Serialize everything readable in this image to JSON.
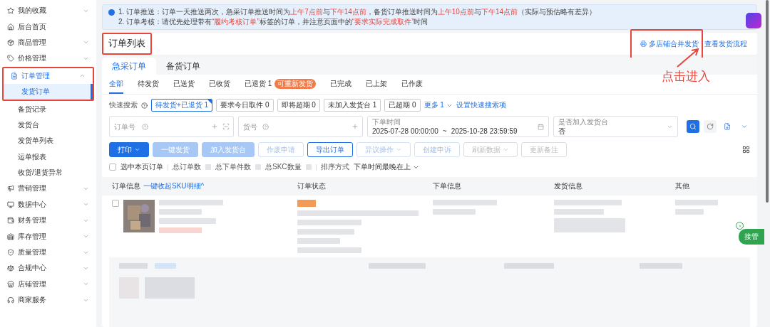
{
  "sidebar": {
    "items": [
      {
        "label": "我的收藏",
        "kind": "group",
        "expanded": false
      },
      {
        "label": "后台首页",
        "kind": "page"
      },
      {
        "label": "商品管理",
        "kind": "group",
        "expanded": false
      },
      {
        "label": "价格管理",
        "kind": "group",
        "expanded": false
      },
      {
        "label": "订单管理",
        "kind": "group",
        "expanded": true,
        "highlighted": true,
        "children": [
          {
            "label": "发货订单",
            "selected": true
          },
          {
            "label": "备货记录",
            "selected": false
          },
          {
            "label": "发货台",
            "selected": false
          },
          {
            "label": "发货单列表",
            "selected": false
          },
          {
            "label": "运单报表",
            "selected": false
          },
          {
            "label": "收货/退货异常",
            "selected": false
          }
        ]
      },
      {
        "label": "营销管理",
        "kind": "group",
        "expanded": false
      },
      {
        "label": "数据中心",
        "kind": "group",
        "expanded": false
      },
      {
        "label": "财务管理",
        "kind": "group",
        "expanded": false
      },
      {
        "label": "库存管理",
        "kind": "group",
        "expanded": false
      },
      {
        "label": "质量管理",
        "kind": "group",
        "expanded": false
      },
      {
        "label": "合规中心",
        "kind": "group",
        "expanded": false
      },
      {
        "label": "店铺管理",
        "kind": "group",
        "expanded": false
      },
      {
        "label": "商家服务",
        "kind": "group",
        "expanded": false
      }
    ]
  },
  "notice": {
    "lines": [
      [
        {
          "text": "1. 订单推送：订单一天推送两次，急采订单推送时间为",
          "highlight": false
        },
        {
          "text": "上午7点前",
          "highlight": true
        },
        {
          "text": "与",
          "highlight": false
        },
        {
          "text": "下午14点前",
          "highlight": true
        },
        {
          "text": "，备货订单推送时间为",
          "highlight": false
        },
        {
          "text": "上午10点前",
          "highlight": true
        },
        {
          "text": "与",
          "highlight": false
        },
        {
          "text": "下午14点前",
          "highlight": true
        },
        {
          "text": "（实际与预估略有差异）",
          "highlight": false
        }
      ],
      [
        {
          "text": "2. 订单考核：请优先处理带有",
          "highlight": false
        },
        {
          "text": "“履约考核订单”",
          "highlight": true
        },
        {
          "text": "标签的订单，并注意页面中的",
          "highlight": false
        },
        {
          "text": "“要求实际完成取件”",
          "highlight": true
        },
        {
          "text": "时间",
          "highlight": false
        }
      ]
    ]
  },
  "header": {
    "title": "订单列表",
    "title_highlighted": true,
    "links": [
      {
        "label": "多店铺合并发货",
        "highlighted": true
      },
      {
        "label": "查看发货流程",
        "highlighted": false
      }
    ]
  },
  "callout": {
    "text": "点击进入"
  },
  "order_tabs": [
    {
      "label": "急采订单",
      "selected": true
    },
    {
      "label": "备货订单",
      "selected": false
    }
  ],
  "status_tabs": [
    {
      "label": "全部",
      "selected": true
    },
    {
      "label": "待发货",
      "selected": false
    },
    {
      "label": "已送货",
      "selected": false
    },
    {
      "label": "已收货",
      "selected": false
    },
    {
      "label": "已退货 1",
      "selected": false,
      "badge": "可重新发货"
    },
    {
      "label": "已完成",
      "selected": false
    },
    {
      "label": "已上架",
      "selected": false
    },
    {
      "label": "已作废",
      "selected": false
    }
  ],
  "quick_search": {
    "label": "快速搜索",
    "chips": [
      {
        "label": "待发货+已退货 1",
        "selected": true
      },
      {
        "label": "要求今日取件 0",
        "selected": false
      },
      {
        "label": "即将超期 0",
        "selected": false
      },
      {
        "label": "未加入发货台 1",
        "selected": false
      },
      {
        "label": "已超期 0",
        "selected": false
      }
    ],
    "more": "更多 1",
    "settings": "设置快速搜索项"
  },
  "filters": {
    "order_no": {
      "placeholder": "订单号"
    },
    "sku_no": {
      "placeholder": "货号"
    },
    "date_range": {
      "label": "下单时间",
      "start": "2025-07-28 00:00:00",
      "separator": "~",
      "end": "2025-10-28 23:59:59"
    },
    "desk": {
      "label": "是否加入发货台",
      "value": "否"
    }
  },
  "actions": [
    {
      "label": "打印",
      "kind": "primary",
      "disabled": false,
      "dropdown": true
    },
    {
      "label": "一键发货",
      "kind": "primary",
      "disabled": true,
      "dropdown": false
    },
    {
      "label": "加入发货台",
      "kind": "primary",
      "disabled": true,
      "dropdown": false
    },
    {
      "label": "作废申请",
      "kind": "outline",
      "disabled": true,
      "dropdown": false
    },
    {
      "label": "导出订单",
      "kind": "outline",
      "disabled": false,
      "dropdown": false
    },
    {
      "label": "异议操作",
      "kind": "outline",
      "disabled": true,
      "dropdown": true
    },
    {
      "label": "创建申诉",
      "kind": "outline",
      "disabled": true,
      "dropdown": false
    },
    {
      "label": "刷新数据",
      "kind": "plain",
      "disabled": true,
      "dropdown": true
    },
    {
      "label": "更新备注",
      "kind": "plain",
      "disabled": true,
      "dropdown": false
    }
  ],
  "summary": {
    "select_all": {
      "label": "选中本页订单",
      "checked": false
    },
    "stats": [
      "总订单数",
      "总下单件数",
      "总SKC数量"
    ],
    "sort_label": "排序方式",
    "sort_value": "下单时间最晚在上"
  },
  "table": {
    "columns": [
      {
        "label": "订单信息",
        "link": "一键收起SKU明细^"
      },
      {
        "label": "订单状态"
      },
      {
        "label": "下单信息"
      },
      {
        "label": "发货信息"
      },
      {
        "label": "其他"
      }
    ],
    "rows": [
      {
        "checked": false
      }
    ]
  },
  "takeover": {
    "label": "接管"
  }
}
